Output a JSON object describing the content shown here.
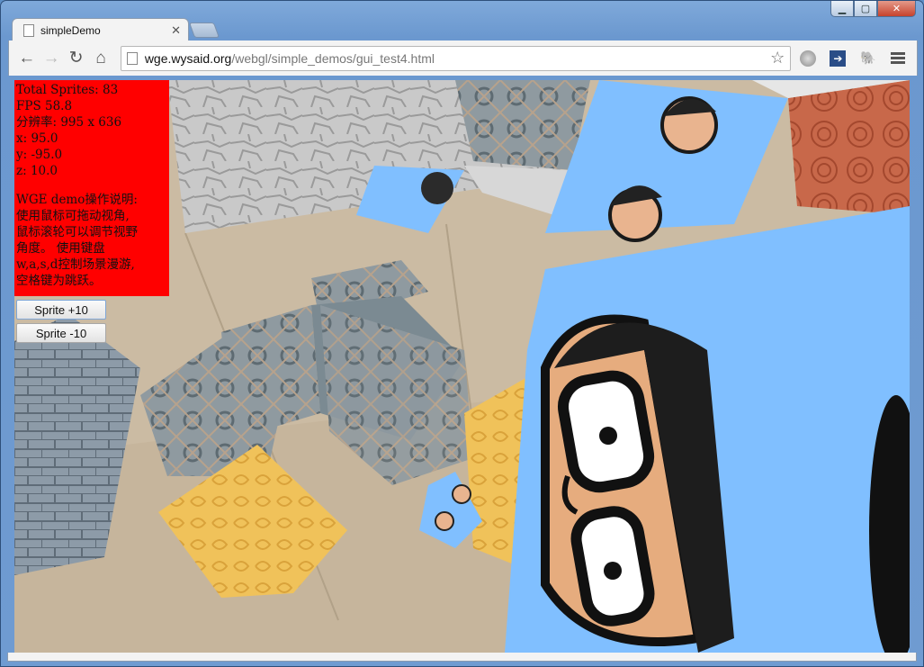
{
  "window": {
    "controls": {
      "minimize": "▁",
      "maximize": "▢",
      "close": "✕"
    }
  },
  "tab": {
    "title": "simpleDemo",
    "close": "✕"
  },
  "toolbar": {
    "back_icon": "←",
    "forward_icon": "→",
    "reload_icon": "↻",
    "home_icon": "⌂",
    "url_host": "wge.wysaid.org",
    "url_path": "/webgl/simple_demos/gui_test4.html",
    "bookmark_icon": "☆",
    "ext_arrow": "➔",
    "ext_elephant": "🐘"
  },
  "hud": {
    "lines": [
      "Total Sprites: 83",
      "FPS 58.8",
      "分辨率: 995 x 636",
      "x: 95.0",
      "y: -95.0",
      "z: 10.0"
    ],
    "instructions": [
      "WGE demo操作说明:",
      "使用鼠标可拖动视角,",
      "鼠标滚轮可以调节视野",
      "角度。 使用键盘",
      "w,a,s,d控制场景漫游,",
      "空格键为跳跃。"
    ]
  },
  "buttons": {
    "plus": "Sprite +10",
    "minus": "Sprite -10"
  },
  "colors": {
    "hud_bg": "#ff0000",
    "sky_blue": "#80bfff",
    "sand": "#cdbfa9",
    "wood": "#c8684a",
    "gold": "#f0c25a",
    "stone": "#8a9aa8"
  }
}
